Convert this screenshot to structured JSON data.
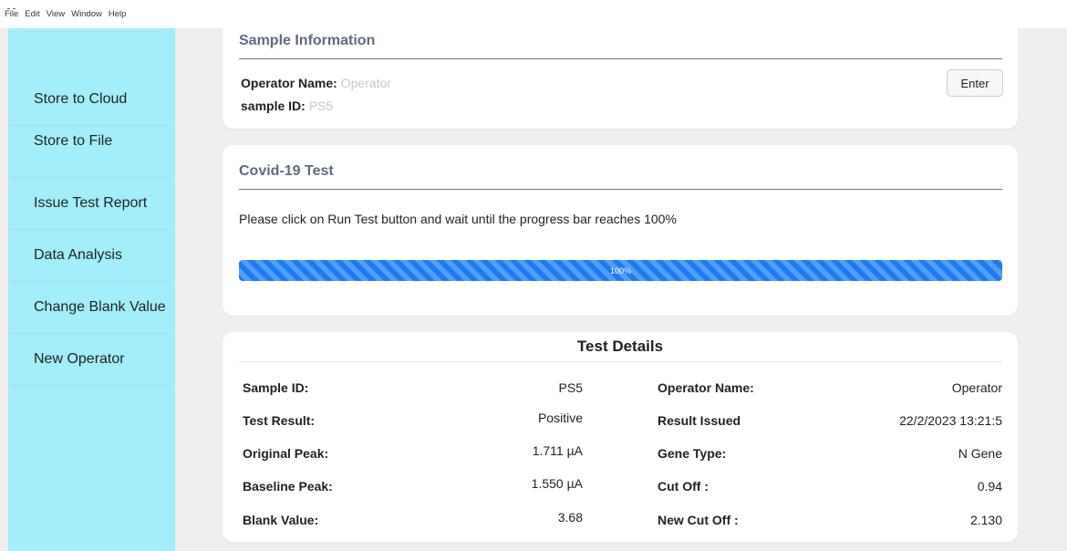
{
  "menubar": {
    "items": [
      "File",
      "Edit",
      "View",
      "Window",
      "Help"
    ]
  },
  "sidebar": {
    "items": [
      {
        "label": "Store to Cloud"
      },
      {
        "label": "Store to File"
      },
      {
        "label": "Issue Test Report"
      },
      {
        "label": "Data Analysis"
      },
      {
        "label": "Change Blank Value"
      },
      {
        "label": "New Operator"
      }
    ]
  },
  "sample_info": {
    "title": "Sample Information",
    "operator_label": "Operator Name:",
    "operator_value": "Operator",
    "sample_label": "sample ID:",
    "sample_value": "PS5",
    "enter_label": "Enter"
  },
  "covid_test": {
    "title": "Covid-19 Test",
    "instruction": "Please click on Run Test button and wait until the progress bar reaches 100%",
    "progress_percent": 100,
    "progress_label": "100%",
    "progress_color": "#1a7cf5"
  },
  "test_details": {
    "title": "Test Details",
    "rows": [
      {
        "left_label": "Sample ID:",
        "left_value": "PS5",
        "right_label": "Operator Name:",
        "right_value": "Operator"
      },
      {
        "left_label": "Test Result:",
        "left_value": "Positive",
        "right_label": "Result Issued",
        "right_value": "22/2/2023 13:21:5"
      },
      {
        "left_label": "Original Peak:",
        "left_value": "1.711 µA",
        "right_label": "Gene Type:",
        "right_value": "N Gene"
      },
      {
        "left_label": "Baseline Peak:",
        "left_value": "1.550 µA",
        "right_label": "Cut Off :",
        "right_value": "0.94"
      },
      {
        "left_label": "Blank Value:",
        "left_value": "3.68",
        "right_label": "New Cut Off :",
        "right_value": "2.130"
      }
    ]
  },
  "colors": {
    "sidebar_bg": "#a3eefa",
    "card_title": "#5e6b80",
    "main_bg": "#efefef"
  }
}
